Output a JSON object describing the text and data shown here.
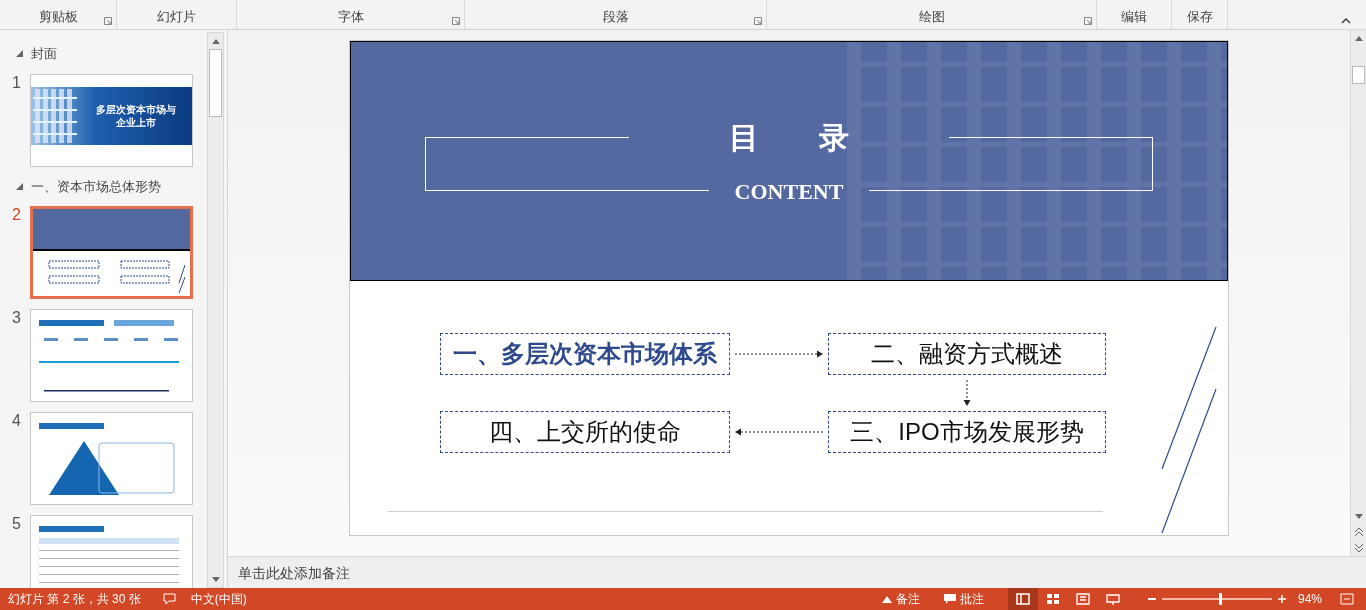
{
  "ribbon": {
    "groups": [
      {
        "label": "剪贴板",
        "launcher": true
      },
      {
        "label": "幻灯片",
        "launcher": false
      },
      {
        "label": "字体",
        "launcher": true
      },
      {
        "label": "段落",
        "launcher": true
      },
      {
        "label": "绘图",
        "launcher": true
      },
      {
        "label": "编辑",
        "launcher": false
      },
      {
        "label": "保存",
        "launcher": false
      }
    ]
  },
  "slide_panel": {
    "sections": [
      {
        "title": "封面",
        "expanded": true,
        "slides": [
          {
            "number": "1",
            "selected": false,
            "kind": "cover",
            "title_lines": [
              "多层次资本市场与",
              "企业上市"
            ]
          }
        ]
      },
      {
        "title": "一、资本市场总体形势",
        "expanded": true,
        "slides": [
          {
            "number": "2",
            "selected": true,
            "kind": "contents"
          },
          {
            "number": "3",
            "selected": false,
            "kind": "timeline"
          },
          {
            "number": "4",
            "selected": false,
            "kind": "pyramid"
          },
          {
            "number": "5",
            "selected": false,
            "kind": "table"
          }
        ]
      }
    ]
  },
  "slide": {
    "title": "目　　录",
    "subtitle": "CONTENT",
    "items": [
      {
        "label": "一、多层次资本市场体系",
        "highlighted": true
      },
      {
        "label": "二、融资方式概述",
        "highlighted": false
      },
      {
        "label": "四、上交所的使命",
        "highlighted": false
      },
      {
        "label": "三、IPO市场发展形势",
        "highlighted": false
      }
    ]
  },
  "notes": {
    "placeholder": "单击此处添加备注"
  },
  "status_bar": {
    "slide_info": "幻灯片 第 2 张，共 30 张",
    "language": "中文(中国)",
    "notes": "备注",
    "comments": "批注",
    "views": [
      {
        "kind": "normal",
        "selected": true
      },
      {
        "kind": "sorter",
        "selected": false
      },
      {
        "kind": "reading",
        "selected": false
      },
      {
        "kind": "slideshow",
        "selected": false
      }
    ],
    "zoom": {
      "level": 0.52,
      "label": "94%"
    }
  }
}
